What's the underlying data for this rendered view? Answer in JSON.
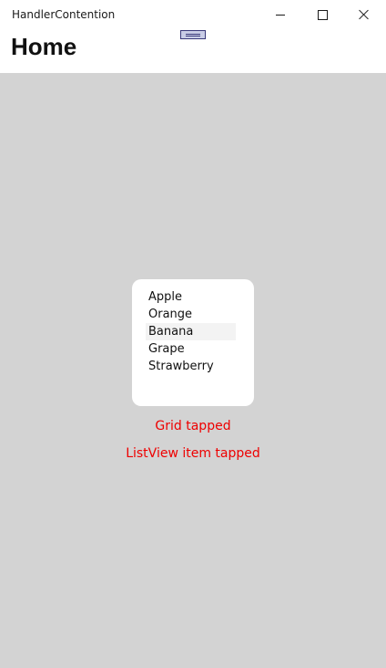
{
  "window": {
    "title": "HandlerContention",
    "minimize_icon": "minimize-icon",
    "maximize_icon": "maximize-icon",
    "close_icon": "close-icon"
  },
  "page": {
    "title": "Home"
  },
  "list": {
    "items": [
      "Apple",
      "Orange",
      "Banana",
      "Grape",
      "Strawberry"
    ],
    "selected": "Banana"
  },
  "status": {
    "grid_message": "Grid tapped",
    "listview_message": "ListView item tapped",
    "color": "#ee0000"
  },
  "colors": {
    "content_background": "#d3d3d3",
    "card_background": "#ffffff"
  }
}
